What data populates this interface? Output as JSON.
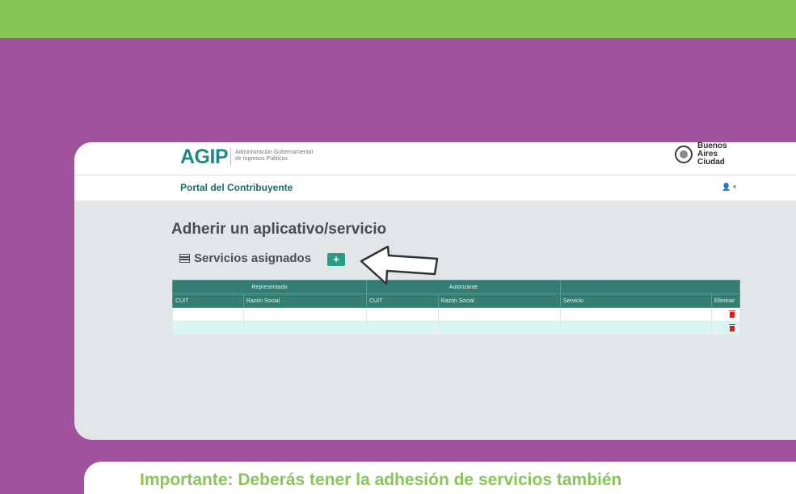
{
  "header": {
    "logo_text": "AGIP",
    "logo_sub_line1": "Administración Gubernamental",
    "logo_sub_line2": "de Ingresos Públicos",
    "ba_line1": "Buenos",
    "ba_line2": "Aires",
    "ba_line3": "Ciudad"
  },
  "nav": {
    "portal_title": "Portal del Contribuyente",
    "user_menu": "👤 ▾"
  },
  "page": {
    "title": "Adherir un aplicativo/servicio",
    "section_title": "Servicios asignados",
    "add_label": "+"
  },
  "table": {
    "groups": [
      "Representado",
      "Autorizante",
      ""
    ],
    "columns": [
      "CUIT",
      "Razón Social",
      "CUIT",
      "Razón Social",
      "Servicio",
      "Eliminar"
    ],
    "rows": [
      {
        "cells": [
          "",
          "",
          "",
          "·",
          "",
          ""
        ]
      },
      {
        "cells": [
          "",
          "",
          "",
          "",
          "",
          ""
        ]
      }
    ]
  },
  "footer_card": {
    "text": "Importante: Deberás tener la adhesión de servicios también"
  },
  "colors": {
    "background": "#a0529c",
    "top_band": "#88c657",
    "table_header": "#347d72",
    "add_button": "#2b9d87",
    "delete_icon": "#e01b1b"
  }
}
